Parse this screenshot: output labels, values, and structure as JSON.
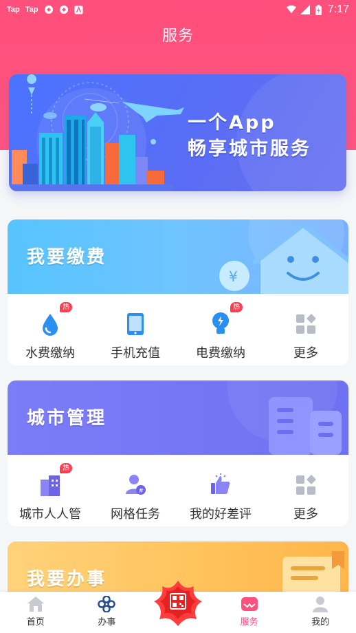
{
  "status_bar": {
    "left_items": [
      "Tap",
      "Tap"
    ],
    "time": "7:17"
  },
  "header": {
    "title": "服务"
  },
  "banner": {
    "line1": "一个App",
    "line2": "畅享城市服务"
  },
  "sections": [
    {
      "title": "我要缴费",
      "items": [
        {
          "label": "水费缴纳",
          "icon": "water-drop-icon",
          "hot": "热"
        },
        {
          "label": "手机充值",
          "icon": "phone-icon",
          "hot": ""
        },
        {
          "label": "电费缴纳",
          "icon": "bulb-icon",
          "hot": "热"
        },
        {
          "label": "更多",
          "icon": "grid-more-icon",
          "hot": ""
        }
      ]
    },
    {
      "title": "城市管理",
      "items": [
        {
          "label": "城市人人管",
          "icon": "building-icon",
          "hot": "热"
        },
        {
          "label": "网格任务",
          "icon": "user-task-icon",
          "hot": ""
        },
        {
          "label": "我的好差评",
          "icon": "thumbs-up-icon",
          "hot": ""
        },
        {
          "label": "更多",
          "icon": "grid-more-icon",
          "hot": ""
        }
      ]
    },
    {
      "title": "我要办事",
      "items": []
    }
  ],
  "tabbar": {
    "items": [
      {
        "label": "首页",
        "icon": "home-icon"
      },
      {
        "label": "办事",
        "icon": "knot-icon"
      },
      {
        "label": "",
        "icon": "qr-flower-icon"
      },
      {
        "label": "服务",
        "icon": "service-icon"
      },
      {
        "label": "我的",
        "icon": "profile-icon"
      }
    ],
    "active_index": 3
  },
  "colors": {
    "brand": "#ff4f7c",
    "banner": "#4b73ff",
    "pay_card": "#57c4ff",
    "city_card": "#7b7cf7",
    "affairs_card": "#ffc25a"
  }
}
